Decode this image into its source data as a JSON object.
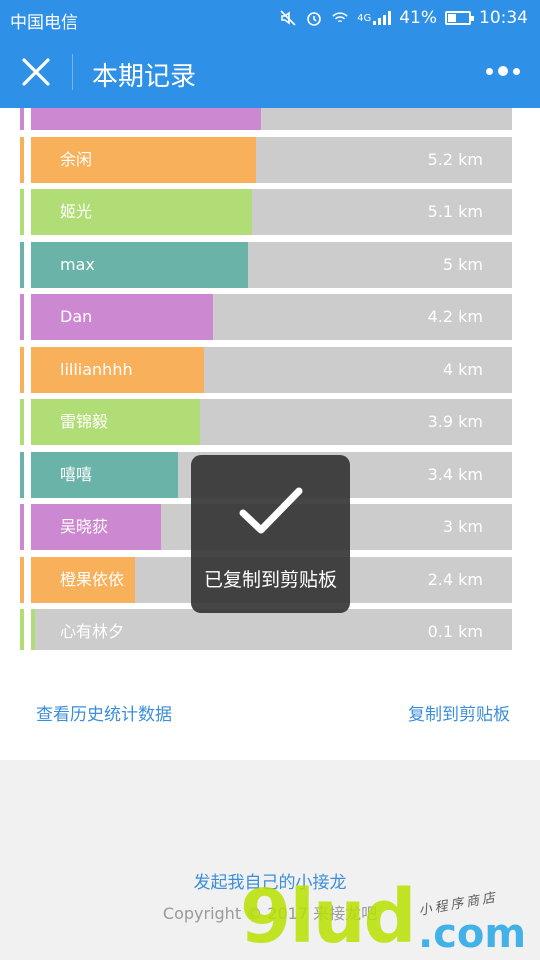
{
  "status_bar": {
    "carrier": "中国电信",
    "network": "4G",
    "battery_percent": "41%",
    "battery_level": 0.41,
    "time": "10:34",
    "icons": [
      "mute-icon",
      "alarm-icon",
      "wifi-icon",
      "signal-icon",
      "battery-icon"
    ]
  },
  "header": {
    "title": "本期记录",
    "close_icon": "close-icon",
    "more_icon": "more-icon"
  },
  "colors": {
    "brand": "#2f90e8",
    "purple": "#cc88d0",
    "orange": "#f8b05a",
    "green": "#b0dd76",
    "teal": "#6ab3a8",
    "track": "#cccccc",
    "link": "#3b8ed8"
  },
  "records": [
    {
      "name": "",
      "distance": "",
      "km": 5.3,
      "color": "#cc88d0"
    },
    {
      "name": "余闲",
      "distance": "5.2 km",
      "km": 5.2,
      "color": "#f8b05a"
    },
    {
      "name": "姬光",
      "distance": "5.1 km",
      "km": 5.1,
      "color": "#b0dd76"
    },
    {
      "name": "max",
      "distance": "5 km",
      "km": 5.0,
      "color": "#6ab3a8"
    },
    {
      "name": "Dan",
      "distance": "4.2 km",
      "km": 4.2,
      "color": "#cc88d0"
    },
    {
      "name": "lillianhhh",
      "distance": "4 km",
      "km": 4.0,
      "color": "#f8b05a"
    },
    {
      "name": "雷锦毅",
      "distance": "3.9 km",
      "km": 3.9,
      "color": "#b0dd76"
    },
    {
      "name": "嘻嘻",
      "distance": "3.4 km",
      "km": 3.4,
      "color": "#6ab3a8"
    },
    {
      "name": "吴晓荻",
      "distance": "3 km",
      "km": 3.0,
      "color": "#cc88d0"
    },
    {
      "name": "橙果依依",
      "distance": "2.4 km",
      "km": 2.4,
      "color": "#f8b05a"
    },
    {
      "name": "心有林夕",
      "distance": "0.1 km",
      "km": 0.1,
      "color": "#b0dd76"
    }
  ],
  "links": {
    "history": "查看历史统计数据",
    "copy": "复制到剪贴板"
  },
  "footer": {
    "launch": "发起我自己的小接龙",
    "copyright": "Copyright © 2017 来接龙吧"
  },
  "watermark": {
    "big": "9lud",
    "com": ".com",
    "sub": "小程序商店"
  },
  "toast": {
    "message": "已复制到剪贴板",
    "icon": "checkmark-icon"
  }
}
